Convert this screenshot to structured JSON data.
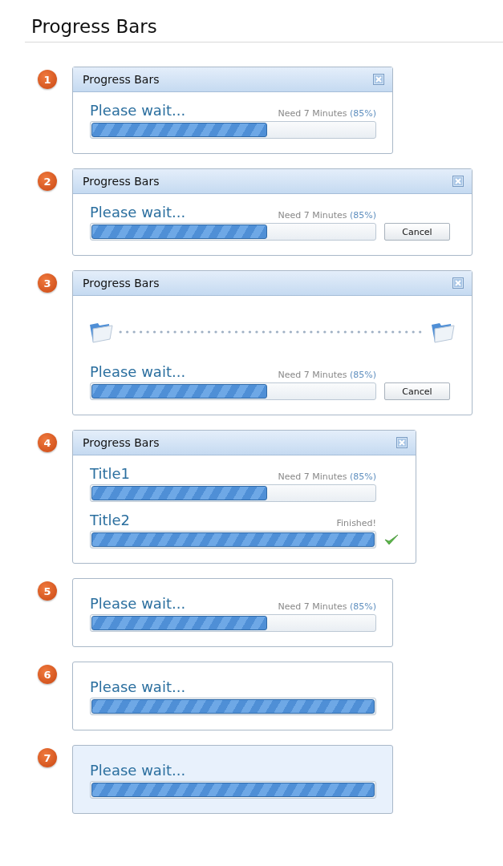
{
  "page_title": "Progress Bars",
  "examples": [
    {
      "number": "1",
      "window_title": "Progress Bars",
      "bars": [
        {
          "label": "Please wait...",
          "status": "Need 7 Minutes",
          "percent": "(85%)",
          "level": 0.62
        }
      ]
    },
    {
      "number": "2",
      "window_title": "Progress Bars",
      "cancel": "Cancel",
      "bars": [
        {
          "label": "Please wait...",
          "status": "Need 7 Minutes",
          "percent": "(85%)",
          "level": 0.62
        }
      ]
    },
    {
      "number": "3",
      "window_title": "Progress Bars",
      "transfer": true,
      "cancel": "Cancel",
      "bars": [
        {
          "label": "Please wait...",
          "status": "Need 7 Minutes",
          "percent": "(85%)",
          "level": 0.62
        }
      ]
    },
    {
      "number": "4",
      "window_title": "Progress Bars",
      "bars": [
        {
          "label": "Title1",
          "status": "Need 7 Minutes",
          "percent": "(85%)",
          "level": 0.62
        },
        {
          "label": "Title2",
          "status": "Finished!",
          "level": 1,
          "done": true
        }
      ]
    },
    {
      "number": "5",
      "bars": [
        {
          "label": "Please wait...",
          "status": "Need 7 Minutes",
          "percent": "(85%)",
          "level": 0.62
        }
      ]
    },
    {
      "number": "6",
      "bars": [
        {
          "label": "Please wait...",
          "level": 1
        }
      ]
    },
    {
      "number": "7",
      "tinted": true,
      "bars": [
        {
          "label": "Please wait...",
          "level": 1
        }
      ]
    }
  ]
}
